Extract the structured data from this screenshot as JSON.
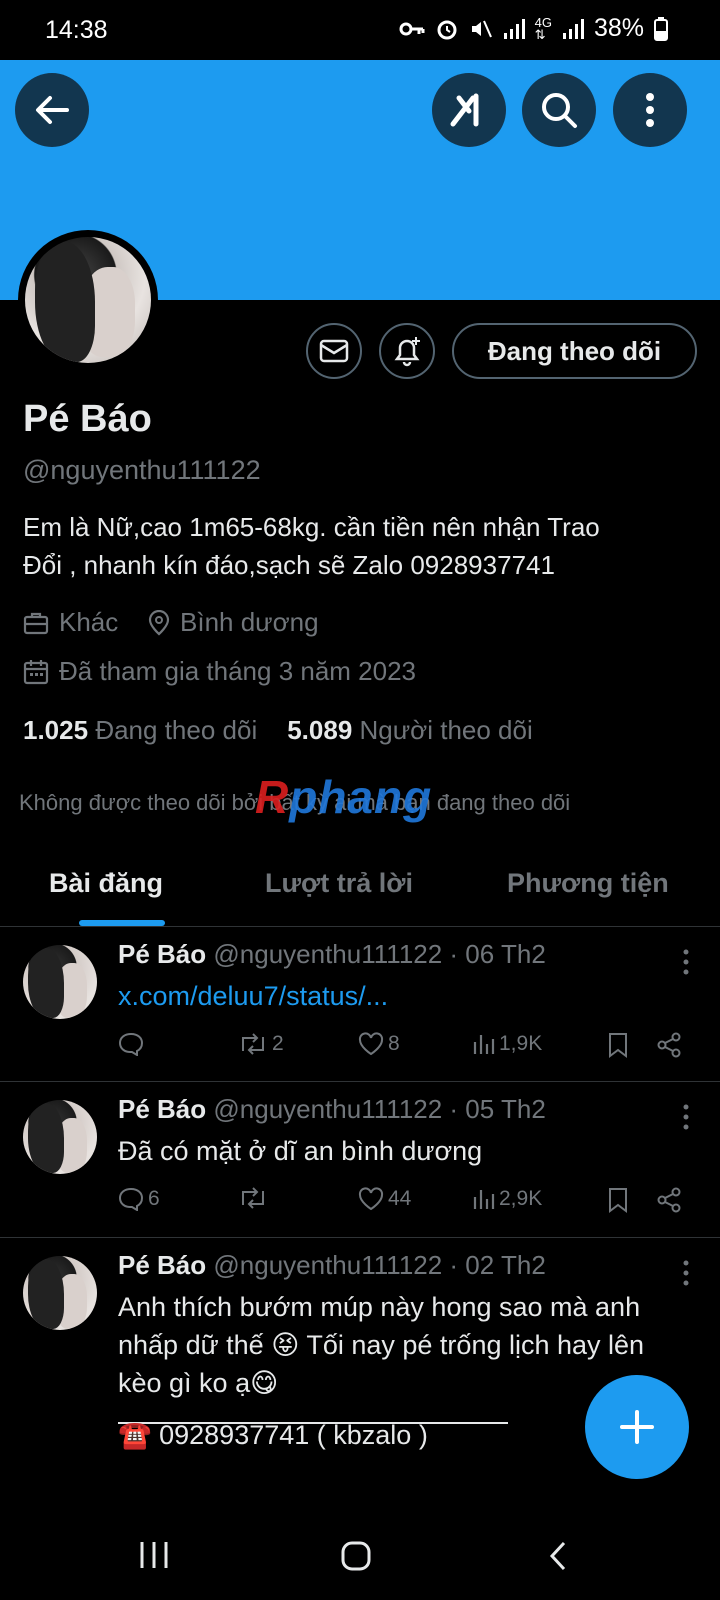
{
  "status": {
    "time": "14:38",
    "battery": "38%"
  },
  "profile": {
    "name": "Pé Báo",
    "handle": "@nguyenthu111122",
    "bio_line1": "Em là Nữ,cao 1m65-68kg. cần tiền nên nhận Trao",
    "bio_line2": "Đổi , nhanh kín đáo,sạch sẽ Zalo 0928937741",
    "category": "Khác",
    "location": "Bình dương",
    "joined": "Đã tham gia tháng 3 năm 2023",
    "following_count": "1.025",
    "following_label": "Đang theo dõi",
    "followers_count": "5.089",
    "followers_label": "Người theo dõi",
    "not_followed": "Không được theo dõi bởi bất kỳ ai mà bạn đang theo dõi",
    "follow_button": "Đang theo dõi"
  },
  "watermark": {
    "r": "R",
    "rest": "phang"
  },
  "tabs": [
    "Bài đăng",
    "Lượt trả lời",
    "Phương tiện"
  ],
  "posts": [
    {
      "name": "Pé Báo",
      "meta": "@nguyenthu111122 · 06 Th2",
      "text": "x.com/deluu7/status/...",
      "replies": "",
      "reposts": "2",
      "likes": "8",
      "views": "1,9K"
    },
    {
      "name": "Pé Báo",
      "meta": "@nguyenthu111122 · 05 Th2",
      "text": "Đã có mặt ở dĩ an bình dương",
      "replies": "6",
      "reposts": "",
      "likes": "44",
      "views": "2,9K"
    },
    {
      "name": "Pé Báo",
      "meta": "@nguyenthu111122 · 02 Th2",
      "text1": "Anh thích bướm múp này hong sao mà anh",
      "text2": "nhấp dữ thế 😝 Tối nay pé trống lịch hay lên",
      "text3": "kèo gì ko ạ😋",
      "phone": "☎️ 0928937741 ( kbzalo )"
    }
  ],
  "colors": {
    "accent": "#1d9bf0",
    "background": "#000000",
    "muted": "#71767b",
    "text": "#e7e9ea"
  }
}
